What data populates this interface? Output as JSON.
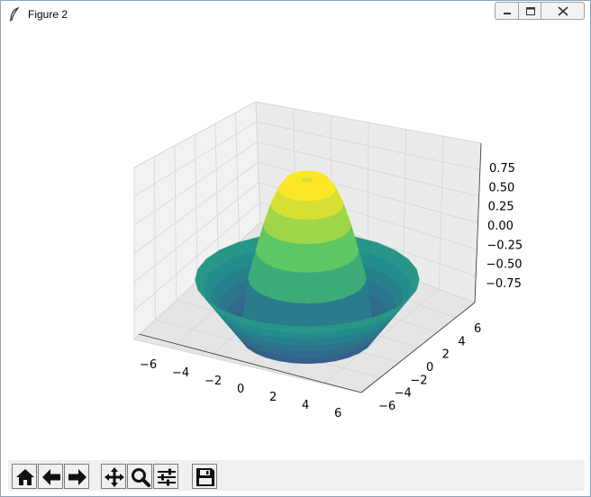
{
  "window": {
    "title": "Figure 2"
  },
  "toolbar": {
    "buttons": [
      {
        "name": "home-button",
        "icon": "home-icon"
      },
      {
        "name": "back-button",
        "icon": "back-arrow-icon"
      },
      {
        "name": "forward-button",
        "icon": "forward-arrow-icon"
      },
      {
        "name": "pan-button",
        "icon": "move-icon"
      },
      {
        "name": "zoom-button",
        "icon": "magnifier-icon"
      },
      {
        "name": "configure-subplots-button",
        "icon": "sliders-icon"
      },
      {
        "name": "save-button",
        "icon": "floppy-disk-icon"
      }
    ]
  },
  "chart_data": {
    "type": "surface",
    "title": "",
    "xlabel": "",
    "ylabel": "",
    "zlabel": "",
    "x_ticks": [
      "−6",
      "−4",
      "−2",
      "0",
      "2",
      "4",
      "6"
    ],
    "y_ticks": [
      "−6",
      "−4",
      "−2",
      "0",
      "2",
      "4",
      "6"
    ],
    "z_ticks": [
      "0.75",
      "0.50",
      "0.25",
      "0.00",
      "−0.25",
      "−0.50",
      "−0.75"
    ],
    "xlim": [
      -6,
      6
    ],
    "ylim": [
      -6,
      6
    ],
    "zlim": [
      -0.9,
      0.9
    ],
    "grid": true,
    "colormap": "viridis",
    "colormap_stops": [
      "#440154",
      "#3b528b",
      "#21918c",
      "#5ec962",
      "#fde725"
    ]
  }
}
